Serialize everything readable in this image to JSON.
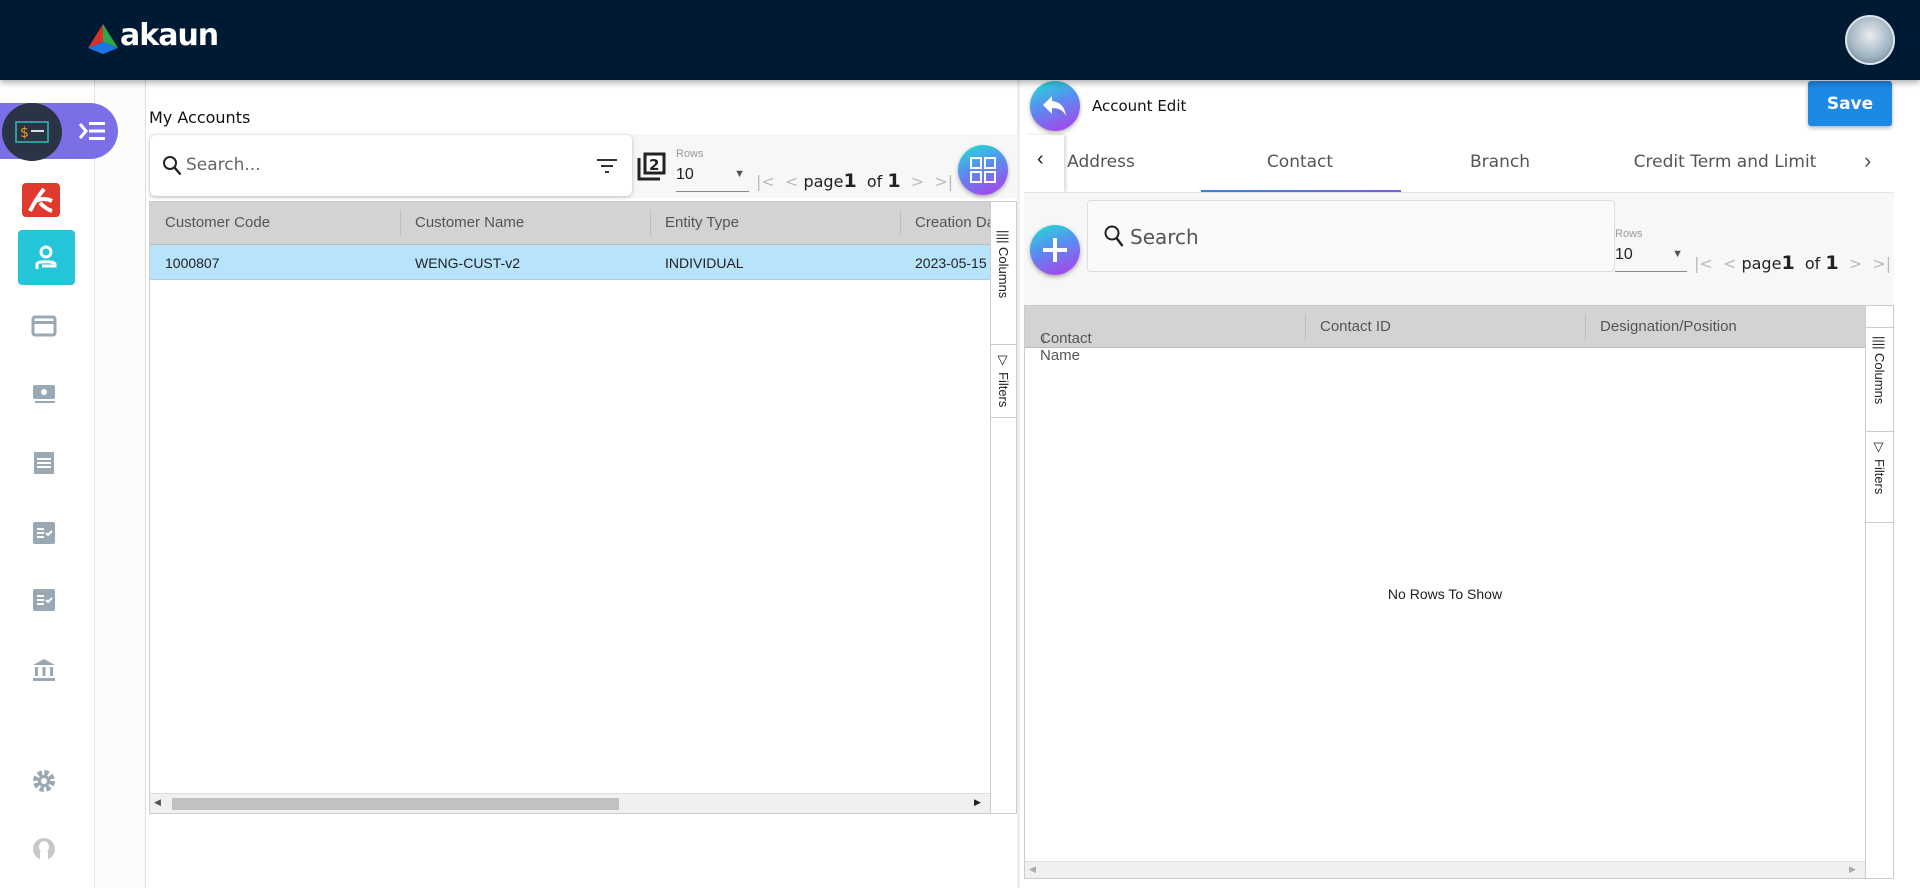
{
  "header": {
    "logo_text": "akaun",
    "avatar": "user-avatar"
  },
  "sidebar": {
    "items": [
      {
        "icon": "money-menu-icon",
        "active": false
      },
      {
        "icon": "app-logo-icon"
      },
      {
        "icon": "person-icon",
        "active": true
      },
      {
        "icon": "card-icon"
      },
      {
        "icon": "cash-icon"
      },
      {
        "icon": "receipt-icon"
      },
      {
        "icon": "checklist-icon"
      },
      {
        "icon": "checklist-icon"
      },
      {
        "icon": "bank-icon"
      },
      {
        "icon": "gear-icon"
      },
      {
        "icon": "user-icon"
      }
    ]
  },
  "accounts": {
    "title": "My Accounts",
    "search_placeholder": "Search...",
    "rows_label": "Rows",
    "rows_value": "10",
    "pager": {
      "page_word": "page",
      "page": "1",
      "of_word": "of",
      "total": "1"
    },
    "columns": [
      "Customer Code",
      "Customer Name",
      "Entity Type",
      "Creation Da"
    ],
    "rows": [
      [
        "1000807",
        "WENG-CUST-v2",
        "INDIVIDUAL",
        "2023-05-15"
      ]
    ],
    "side_columns": "Columns",
    "side_filters": "Filters"
  },
  "edit": {
    "title": "Account Edit",
    "save_label": "Save",
    "tabs": [
      "Address",
      "Contact",
      "Branch",
      "Credit Term and Limit"
    ],
    "active_tab": "Contact",
    "search_placeholder": "Search",
    "rows_label": "Rows",
    "rows_value": "10",
    "pager": {
      "page_word": "page",
      "page": "1",
      "of_word": "of",
      "total": "1"
    },
    "columns": [
      "Contact Name",
      "Contact ID",
      "Designation/Position"
    ],
    "empty_text": "No Rows To Show",
    "side_columns": "Columns",
    "side_filters": "Filters"
  },
  "colors": {
    "topbar": "#011a33",
    "accent": "#1e88e5",
    "active_sidebar": "#26c6da",
    "selected_row": "#b7e3fb"
  }
}
